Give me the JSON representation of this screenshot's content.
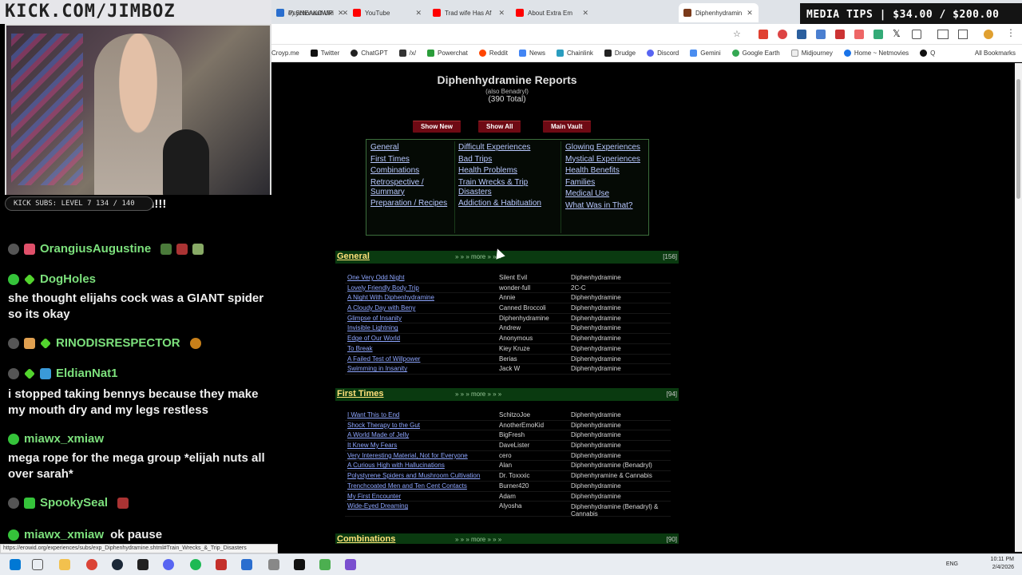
{
  "stream": {
    "title": "KICK.COM/JIMBOZ",
    "subs": "KICK SUBS: LEVEL 7 134 / 140",
    "media_tips": "MEDIA TIPS | $34.00 / $200.00"
  },
  "chat": [
    {
      "kind": "text",
      "text": "a penis to fuck Elijah with!!!"
    },
    {
      "kind": "user",
      "name": "OrangiusAugustine",
      "color": "#7ce07c"
    },
    {
      "kind": "user",
      "name": "DogHoles",
      "color": "#7ce07c"
    },
    {
      "kind": "text",
      "text": "she thought elijahs cock was a GIANT spider so its okay"
    },
    {
      "kind": "user",
      "name": "RINODISRESPECTOR",
      "color": "#7ce07c"
    },
    {
      "kind": "user",
      "name": "EldianNat1",
      "color": "#7ce07c"
    },
    {
      "kind": "text",
      "text": "i stopped taking bennys because they make my mouth dry and my legs restless"
    },
    {
      "kind": "user",
      "name": "miawx_xmiaw",
      "color": "#7ce07c"
    },
    {
      "kind": "text",
      "text": "mega rope for the mega group *elijah nuts all over sarah*"
    },
    {
      "kind": "user",
      "name": "SpookySeal",
      "color": "#7ce07c"
    },
    {
      "kind": "user",
      "name": "miawx_xmiaw",
      "color": "#7ce07c",
      "msg": "ok pause"
    }
  ],
  "browser": {
    "tabs": [
      "o) SNEAKO UP",
      "YouTube",
      "Trad wife Has Af",
      "About Extra Em",
      "PsychonautWiki",
      "Diphenhydramin"
    ],
    "bookmarks": [
      "Croyp.me",
      "Twitter",
      "ChatGPT",
      "/x/",
      "Powerchat",
      "Reddit",
      "News",
      "Chainlink",
      "Drudge",
      "Discord",
      "Gemini",
      "Google Earth",
      "Midjourney",
      "Home ~ Netmovies",
      "Q"
    ],
    "all_bookmarks": "All Bookmarks",
    "status_url": "https://erowid.org/experiences/subs/exp_Diphenhydramine.shtml#Train_Wrecks_&_Trip_Disasters"
  },
  "page": {
    "title": "Diphenhydramine Reports",
    "subtitle": "(also Benadryl)",
    "total": "(390 Total)",
    "buttons": [
      "Show New",
      "Show All",
      "Main Vault"
    ],
    "categories": [
      [
        "General",
        "First Times",
        "Combinations",
        "Retrospective / Summary",
        "Preparation / Recipes"
      ],
      [
        "Difficult Experiences",
        "Bad Trips",
        "Health Problems",
        "Train Wrecks & Trip Disasters",
        "Addiction & Habituation"
      ],
      [
        "Glowing Experiences",
        "Mystical Experiences",
        "Health Benefits",
        "Families",
        "Medical Use",
        "What Was in That?"
      ]
    ],
    "sections": [
      {
        "name": "General",
        "more": "» » »   more   » » »",
        "count": "[156]",
        "rows": [
          [
            "One Very Odd Night",
            "Silent Evil",
            "Diphenhydramine"
          ],
          [
            "Lovely Friendly Body Trip",
            "wonder-full",
            "2C-C"
          ],
          [
            "A Night With Diphenhydramine",
            "Annie",
            "Diphenhydramine"
          ],
          [
            "A Cloudy Day with Beny",
            "Canned Broccoli",
            "Diphenhydramine"
          ],
          [
            "Glimpse of Insanity",
            "Diphenhydramine",
            "Diphenhydramine"
          ],
          [
            "Invisible Lightning",
            "Andrew",
            "Diphenhydramine"
          ],
          [
            "Edge of Our World",
            "Anonymous",
            "Diphenhydramine"
          ],
          [
            "To Break",
            "Kiey Kruze",
            "Diphenhydramine"
          ],
          [
            "A Failed Test of Willpower",
            "Berias",
            "Diphenhydramine"
          ],
          [
            "Swimming in Insanity",
            "Jack W",
            "Diphenhydramine"
          ]
        ]
      },
      {
        "name": "First Times",
        "more": "» » »   more   » » »",
        "count": "[94]",
        "rows": [
          [
            "I Want This to End",
            "SchitzoJoe",
            "Diphenhydramine"
          ],
          [
            "Shock Therapy to the Gut",
            "AnotherEmoKid",
            "Diphenhydramine"
          ],
          [
            "A World Made of Jelly",
            "BigFresh",
            "Diphenhydramine"
          ],
          [
            "It Knew My Fears",
            "DaveLister",
            "Diphenhydramine"
          ],
          [
            "Very Interesting Material, Not for Everyone",
            "cero",
            "Diphenhydramine"
          ],
          [
            "A Curious High with Hallucinations",
            "Alan",
            "Diphenhydramine (Benadryl)"
          ],
          [
            "Polystyrene Spiders and Mushroom Cultivation",
            "Dr. Toxxxic",
            "Diphenhyramine & Cannabis"
          ],
          [
            "Trenchcoated Men and Ten Cent Contacts",
            "Burner420",
            "Diphenhydramine"
          ],
          [
            "My First Encounter",
            "Adam",
            "Diphenhydramine"
          ],
          [
            "Wide-Eyed Dreaming",
            "Alyosha",
            "Diphenhydramine (Benadryl) & Cannabis"
          ]
        ]
      },
      {
        "name": "Combinations",
        "more": "» » »   more   » » »",
        "count": "[90]",
        "rows": []
      }
    ]
  },
  "taskbar": {
    "lang": "ENG",
    "time": "10:11 PM",
    "date": "2/4/2026"
  }
}
